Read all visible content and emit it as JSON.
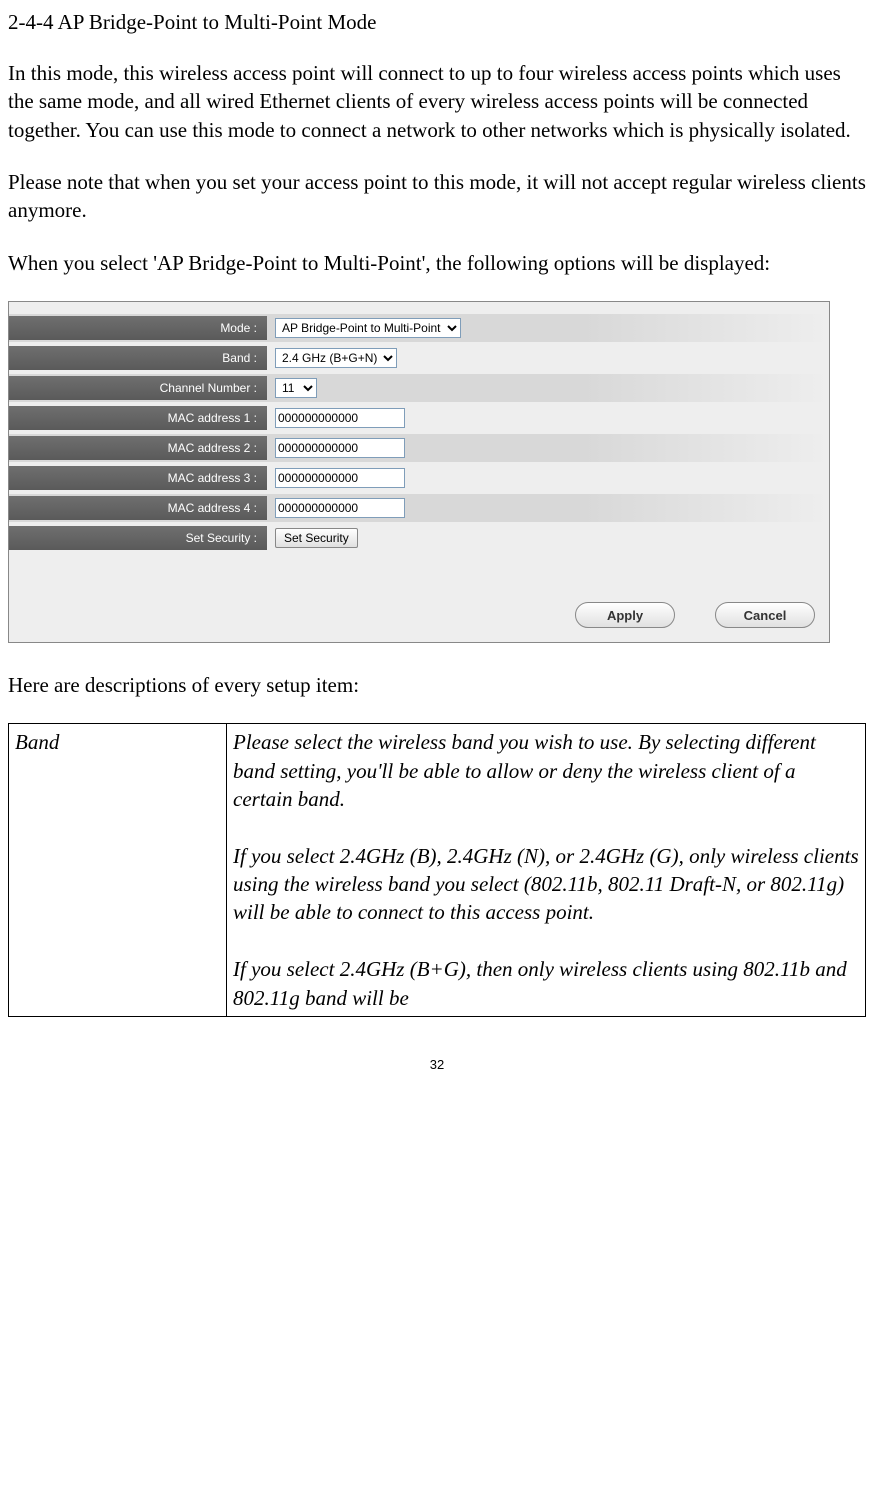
{
  "section_title": "2-4-4 AP Bridge-Point to Multi-Point Mode",
  "para1": "In this mode, this wireless access point will connect to up to four wireless access points which uses the same mode, and all wired Ethernet clients of every wireless access points will be connected together. You can use this mode to connect a network to other networks which is physically isolated.",
  "para2": "Please note that when you set your access point to this mode, it will not accept regular wireless clients anymore.",
  "para3": "When you select 'AP Bridge-Point to Multi-Point', the following options will be displayed:",
  "form": {
    "mode_label": "Mode :",
    "mode_value": "AP Bridge-Point to Multi-Point",
    "band_label": "Band :",
    "band_value": "2.4 GHz (B+G+N)",
    "channel_label": "Channel Number :",
    "channel_value": "11",
    "mac1_label": "MAC address 1 :",
    "mac1_value": "000000000000",
    "mac2_label": "MAC address 2 :",
    "mac2_value": "000000000000",
    "mac3_label": "MAC address 3 :",
    "mac3_value": "000000000000",
    "mac4_label": "MAC address 4 :",
    "mac4_value": "000000000000",
    "setsec_label": "Set Security :",
    "setsec_btn": "Set Security",
    "apply_btn": "Apply",
    "cancel_btn": "Cancel"
  },
  "desc_intro": "Here are descriptions of every setup item:",
  "table": {
    "row1_col1": "Band",
    "row1_col2": "Please select the wireless band you wish to use. By selecting different band setting, you'll be able to allow or deny the wireless client of a certain band.\n\nIf you select 2.4GHz (B), 2.4GHz (N), or 2.4GHz (G), only wireless clients using the wireless band you select (802.11b, 802.11 Draft-N, or 802.11g) will be able to connect to this access point.\n\nIf you select 2.4GHz (B+G), then only wireless clients using 802.11b and 802.11g band will be"
  },
  "page_number": "32"
}
